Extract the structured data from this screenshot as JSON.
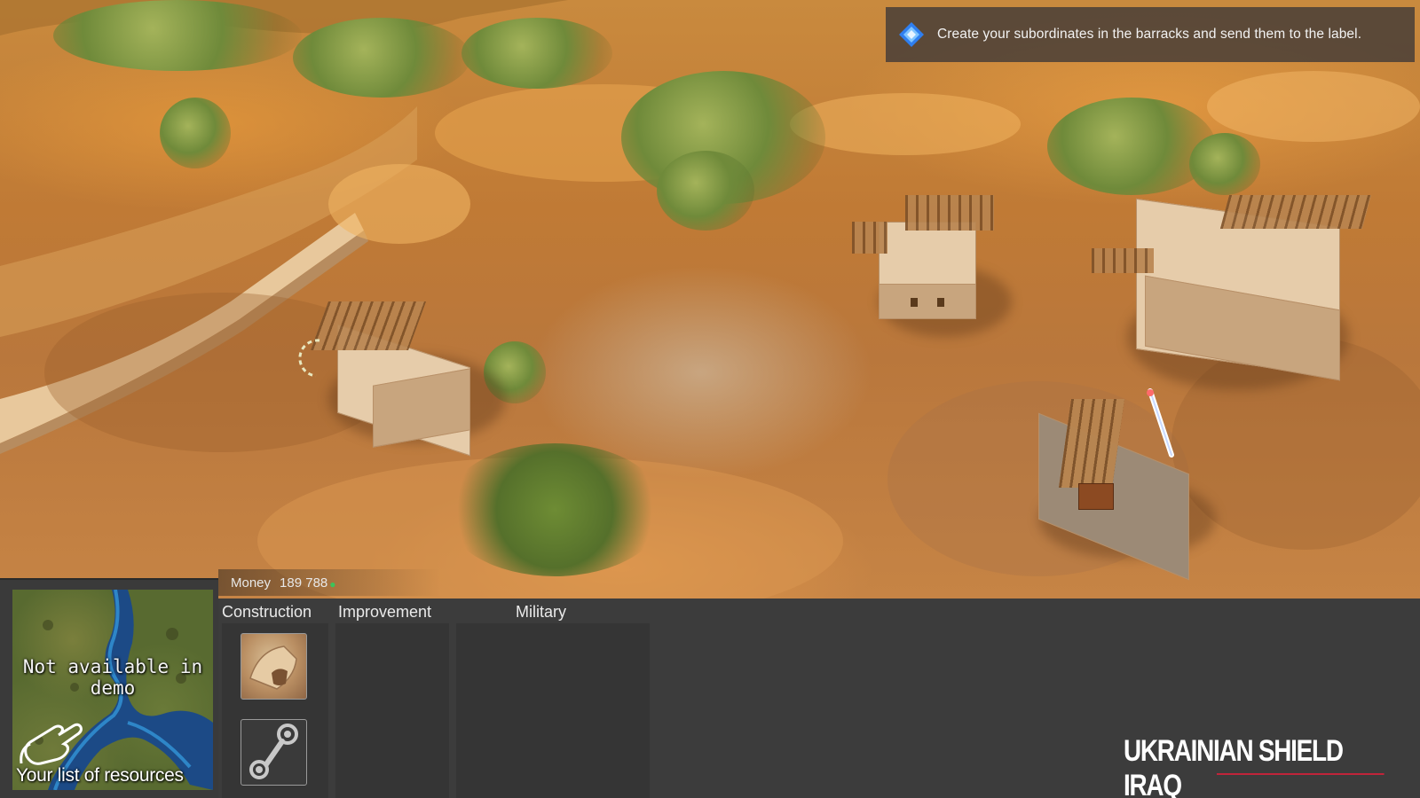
{
  "objective": {
    "icon": "diamond-icon",
    "text": "Create your subordinates in the barracks and send them to the label."
  },
  "money": {
    "label": "Money",
    "value": "189 788",
    "currency_icon": "coin-icon",
    "currency_color": "#3cc45a"
  },
  "minimap": {
    "unavailable_text": "Not available in demo",
    "resources_text": "Your list of resources"
  },
  "tabs": [
    {
      "label": "Construction"
    },
    {
      "label": "Improvement"
    },
    {
      "label": "Military"
    }
  ],
  "slots": [
    {
      "icon": "barracks-building-icon"
    },
    {
      "icon": "steam-icon"
    }
  ],
  "watermark": {
    "text": "UKRAINIAN SHIELD IRAQ"
  },
  "colors": {
    "panel": "#3c3c3c",
    "accent_red": "#c0243a",
    "objective_icon": "#4fa6ff"
  }
}
